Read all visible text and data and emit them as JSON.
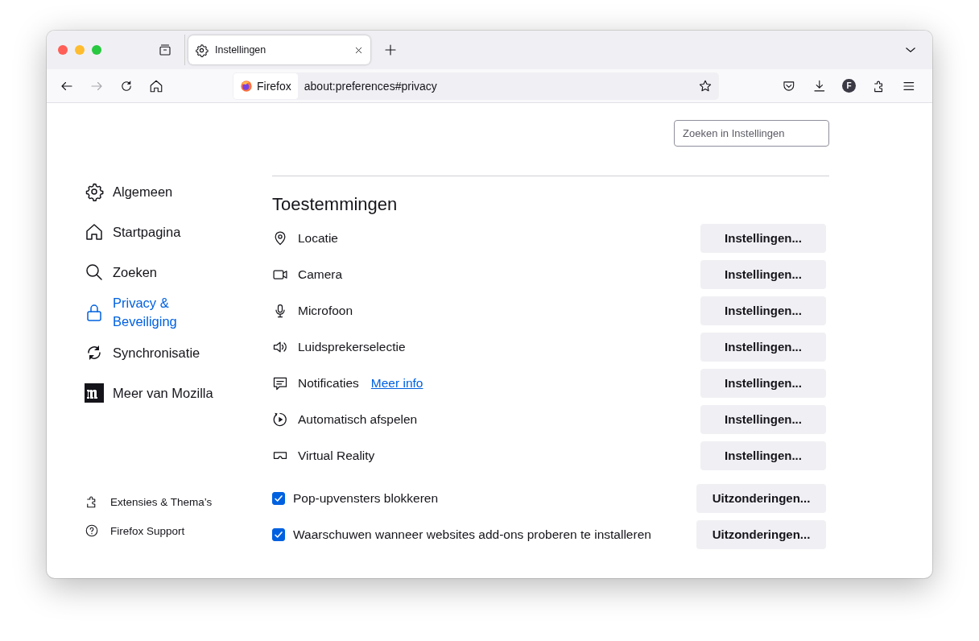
{
  "tabs": [
    {
      "title": "Instellingen",
      "kind": "gear",
      "selected": true
    }
  ],
  "toolbar": {
    "back": {
      "disabled": false
    },
    "forward": {
      "disabled": true
    },
    "identity_label": "Firefox",
    "url": "about:preferences#privacy",
    "account_initial": "F"
  },
  "search": {
    "placeholder": "Zoeken in Instellingen"
  },
  "sidebar": {
    "items": [
      {
        "label": "Algemeen",
        "kind": "gear",
        "selected": false
      },
      {
        "label": "Startpagina",
        "kind": "home",
        "selected": false
      },
      {
        "label": "Zoeken",
        "kind": "search",
        "selected": false
      },
      {
        "label": "Privacy & Beveiliging",
        "kind": "lock",
        "selected": true
      },
      {
        "label": "Synchronisatie",
        "kind": "sync",
        "selected": false
      },
      {
        "label": "Meer van Mozilla",
        "kind": "mozilla",
        "selected": false
      }
    ],
    "footer": [
      {
        "label": "Extensies & Thema’s",
        "kind": "puzzle"
      },
      {
        "label": "Firefox Support",
        "kind": "help"
      }
    ]
  },
  "section": {
    "title": "Toestemmingen",
    "permissions": [
      {
        "label": "Locatie",
        "kind": "pin",
        "button": "Instellingen..."
      },
      {
        "label": "Camera",
        "kind": "camera",
        "button": "Instellingen..."
      },
      {
        "label": "Microfoon",
        "kind": "mic",
        "button": "Instellingen..."
      },
      {
        "label": "Luidsprekerselectie",
        "kind": "speaker",
        "button": "Instellingen..."
      },
      {
        "label": "Notificaties",
        "kind": "chat",
        "link": "Meer info",
        "button": "Instellingen..."
      },
      {
        "label": "Automatisch afspelen",
        "kind": "autoplay",
        "button": "Instellingen..."
      },
      {
        "label": "Virtual Reality",
        "kind": "vr",
        "button": "Instellingen..."
      }
    ],
    "options": [
      {
        "label": "Pop-upvensters blokkeren",
        "checked": true,
        "button": "Uitzonderingen..."
      },
      {
        "label": "Waarschuwen wanneer websites add-ons proberen te installeren",
        "checked": true,
        "button": "Uitzonderingen..."
      }
    ]
  }
}
